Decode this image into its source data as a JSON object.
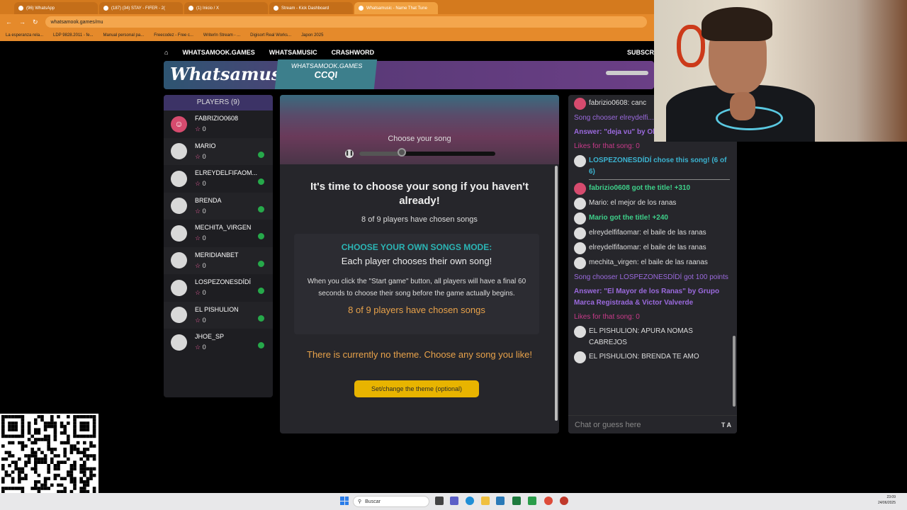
{
  "browser": {
    "tabs": [
      {
        "label": "(96) WhatsApp",
        "active": false
      },
      {
        "label": "(187) (34) STAY - FIFER - 2(",
        "active": false
      },
      {
        "label": "(1) Inicio / X",
        "active": false
      },
      {
        "label": "Stream - Kick Dashboard",
        "active": false
      },
      {
        "label": "Whatsamusic - Name That Tune",
        "active": true
      }
    ],
    "url": "whatsamook.games/mu",
    "bookmarks": [
      "La esperanza rela...",
      "LDP 9828.2011 - fe...",
      "Manual personal pa...",
      "Freecodez - Free c...",
      "WriterIn Stream - ...",
      "Digisort Real Works...",
      "Japon 2025"
    ]
  },
  "site": {
    "nav": [
      "WHATSAMOOK.GAMES",
      "WHATSAMUSIC",
      "CRASHWORD"
    ],
    "subscribe": "SUBSCR",
    "logo": "Whatsamusic",
    "banner_site": "WHATSAMOOK.GAMES",
    "banner_code": "CCQI"
  },
  "players": {
    "header": "PLAYERS (9)",
    "list": [
      {
        "name": "FABRIZIO0608",
        "score": "0",
        "ready": false,
        "avatar": "red"
      },
      {
        "name": "MARIO",
        "score": "0",
        "ready": true,
        "avatar": "grey"
      },
      {
        "name": "ELREYDELFIFAOM...",
        "score": "0",
        "ready": true,
        "avatar": "grey"
      },
      {
        "name": "BRENDA",
        "score": "0",
        "ready": true,
        "avatar": "grey"
      },
      {
        "name": "MECHITA_VIRGEN",
        "score": "0",
        "ready": true,
        "avatar": "grey"
      },
      {
        "name": "MERIDIANBET",
        "score": "0",
        "ready": true,
        "avatar": "grey"
      },
      {
        "name": "LOSPEZONESDÍDÍ",
        "score": "0",
        "ready": true,
        "avatar": "grey"
      },
      {
        "name": "EL PISHULION",
        "score": "0",
        "ready": true,
        "avatar": "grey"
      },
      {
        "name": "JHOE_SP",
        "score": "0",
        "ready": true,
        "avatar": "grey"
      }
    ]
  },
  "center": {
    "choose_label": "Choose your song",
    "progress": 0.31,
    "title": "It's time to choose your song if you haven't already!",
    "chosen_count": "8 of 9 players have chosen songs",
    "mode_title": "CHOOSE YOUR OWN SONGS MODE:",
    "mode_sub": "Each player chooses their own song!",
    "mode_desc": "When you click the \"Start game\" button, all players will have a final 60 seconds to choose their song before the game actually begins.",
    "mode_count": "8 of 9 players have chosen songs",
    "theme_text": "There is currently no theme. Choose any song you like!",
    "theme_button": "Set/change the theme (optional)"
  },
  "chat": {
    "messages": [
      {
        "text": "fabrizio0608: canc",
        "style": "",
        "avatar": "red"
      },
      {
        "text": "Song chooser elreydelfi... points",
        "style": "violet",
        "avatar": ""
      },
      {
        "text": "Answer: \"deja vu\" by Olivia Rodrigo",
        "style": "violetb",
        "avatar": ""
      },
      {
        "text": "Likes for that song: 0",
        "style": "pink",
        "avatar": ""
      },
      {
        "text": "LOSPEZONESDÍDÍ chose this song! (6 of 6)",
        "style": "teal sep",
        "avatar": "grey"
      },
      {
        "text": "fabrizio0608 got the title! +310",
        "style": "green",
        "avatar": "red"
      },
      {
        "text": "Mario: el mejor de los ranas",
        "style": "",
        "avatar": "grey"
      },
      {
        "text": "Mario got the title! +240",
        "style": "green",
        "avatar": "grey"
      },
      {
        "text": "elreydelfifaomar: el baile de las ranas",
        "style": "",
        "avatar": "grey"
      },
      {
        "text": "elreydelfifaomar: el baile de las ranas",
        "style": "",
        "avatar": "grey"
      },
      {
        "text": "mechita_virgen: el baile de las raanas",
        "style": "",
        "avatar": "grey"
      },
      {
        "text": "Song chooser LOSPEZONESDÍDÍ got 100 points",
        "style": "violet",
        "avatar": ""
      },
      {
        "text": "Answer: \"El Mayor de los Ranas\" by Grupo Marca Registrada & Victor Valverde",
        "style": "violetb",
        "avatar": ""
      },
      {
        "text": "Likes for that song: 0",
        "style": "pink",
        "avatar": ""
      },
      {
        "text": "EL PISHULION: APURA NOMAS CABREJOS",
        "style": "",
        "avatar": "grey"
      },
      {
        "text": "EL PISHULION: BRENDA TE AMO",
        "style": "",
        "avatar": "grey"
      }
    ],
    "placeholder": "Chat or guess here",
    "toolbar": "T A"
  },
  "taskbar": {
    "search_placeholder": "Buscar",
    "time": "23:09",
    "date": "24/06/2025"
  },
  "colors": {
    "accent_teal": "#2bb5b5",
    "accent_orange": "#e8a24a",
    "button_yellow": "#e8b400",
    "ready_green": "#26a94a",
    "chat_green": "#3ed08a",
    "chat_violet": "#9b6ade"
  }
}
